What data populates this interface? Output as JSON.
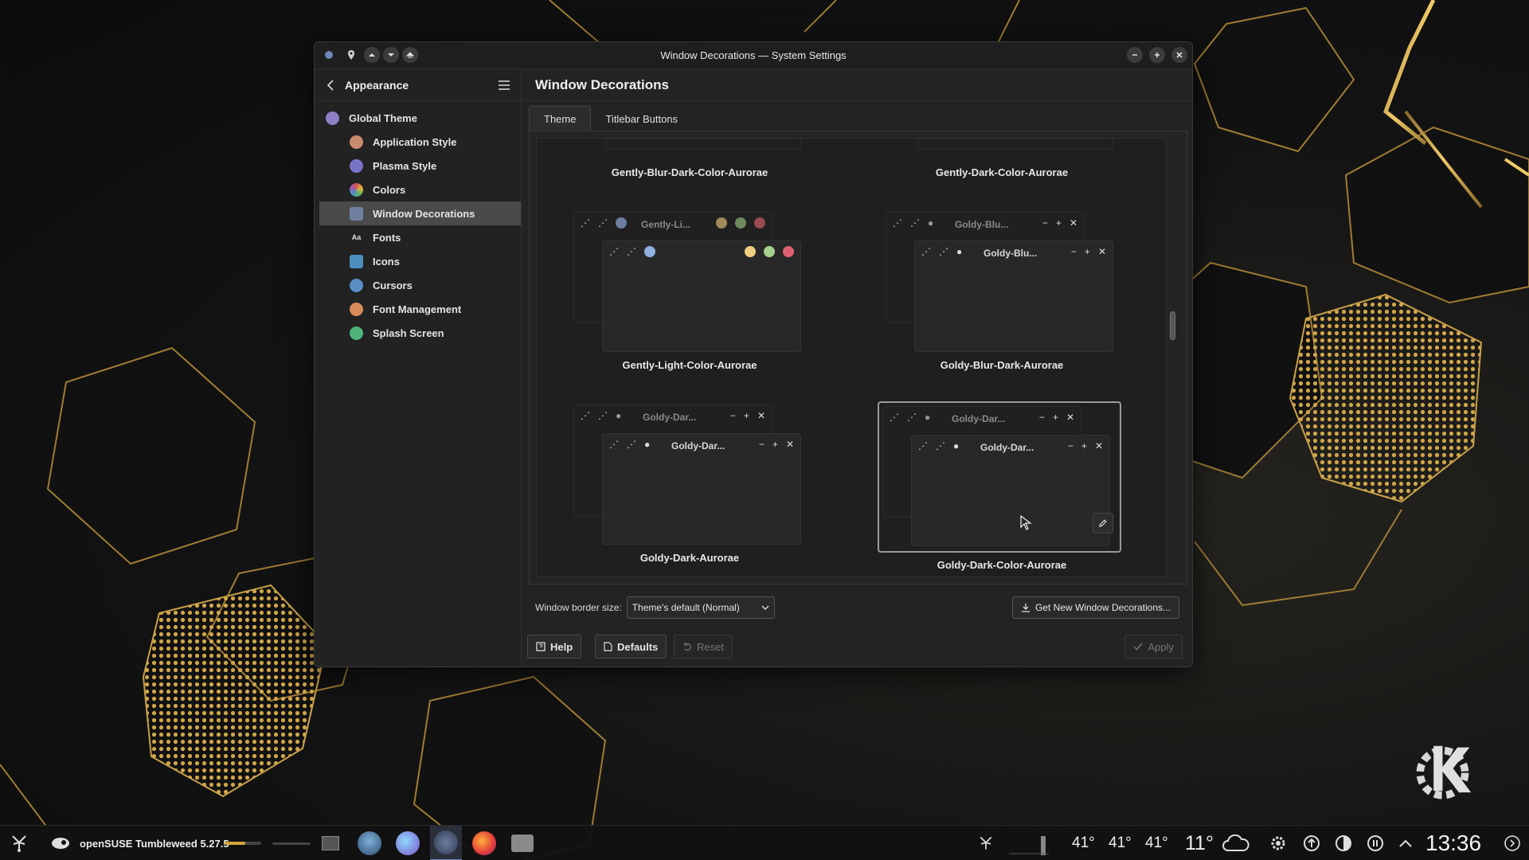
{
  "window": {
    "title": "Window Decorations — System Settings"
  },
  "sidebar": {
    "header": "Appearance",
    "items": [
      {
        "label": "Global Theme",
        "icon": "global-theme-icon",
        "color": "#8e7fc6"
      },
      {
        "label": "Application Style",
        "icon": "application-style-icon",
        "color": "#c98a6e"
      },
      {
        "label": "Plasma Style",
        "icon": "plasma-style-icon",
        "color": "#7a74c9"
      },
      {
        "label": "Colors",
        "icon": "colors-icon",
        "color": "#d6534f"
      },
      {
        "label": "Window Decorations",
        "icon": "window-decorations-icon",
        "color": "#6f7fa0"
      },
      {
        "label": "Fonts",
        "icon": "fonts-icon",
        "color": "#8a8a8a"
      },
      {
        "label": "Icons",
        "icon": "icons-icon",
        "color": "#4c8fbf"
      },
      {
        "label": "Cursors",
        "icon": "cursors-icon",
        "color": "#5a8dc4"
      },
      {
        "label": "Font Management",
        "icon": "font-management-icon",
        "color": "#d98a5a"
      },
      {
        "label": "Splash Screen",
        "icon": "splash-screen-icon",
        "color": "#4fb37a"
      }
    ]
  },
  "main": {
    "title": "Window Decorations",
    "tabs": [
      "Theme",
      "Titlebar Buttons"
    ],
    "themes": [
      {
        "name": "Gently-Blur-Dark-Color-Aurorae",
        "preview_title": ""
      },
      {
        "name": "Gently-Dark-Color-Aurorae",
        "preview_title": ""
      },
      {
        "name": "Gently-Light-Color-Aurorae",
        "preview_title": "Gently-Li..."
      },
      {
        "name": "Goldy-Blur-Dark-Aurorae",
        "preview_title_back": "Goldy-Blu...",
        "preview_title_front": "Goldy-Blu..."
      },
      {
        "name": "Goldy-Dark-Aurorae",
        "preview_title_back": "Goldy-Dar...",
        "preview_title_front": "Goldy-Dar..."
      },
      {
        "name": "Goldy-Dark-Color-Aurorae",
        "preview_title_back": "Goldy-Dar...",
        "preview_title_front": "Goldy-Dar..."
      }
    ],
    "selected_theme": "Goldy-Dark-Color-Aurorae",
    "border_size_label": "Window border size:",
    "border_size_value": "Theme's default (Normal)",
    "get_new_label": "Get New Window Decorations..."
  },
  "footer": {
    "help": "Help",
    "defaults": "Defaults",
    "reset": "Reset",
    "apply": "Apply"
  },
  "taskbar": {
    "distro_label": "openSUSE Tumbleweed 5.27.5",
    "temps": [
      "41°",
      "41°",
      "41°"
    ],
    "weather": "11°",
    "clock": "13:36"
  },
  "colors": {
    "accent_gold": "#d4a63a",
    "selection": "#4a4a4a"
  }
}
